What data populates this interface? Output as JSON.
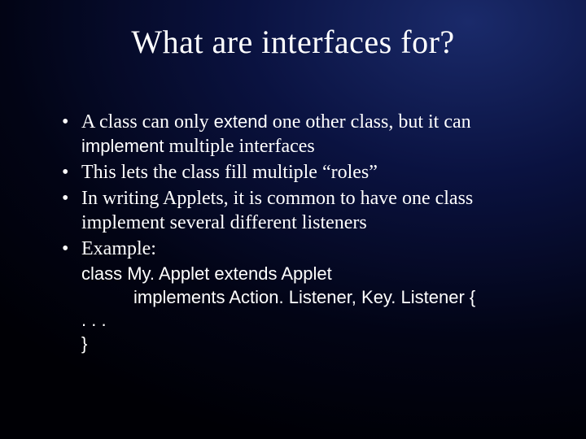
{
  "title": "What are interfaces for?",
  "bullets": {
    "b1a": "A class can only ",
    "b1_kw1": "extend",
    "b1b": " one other class, but it can ",
    "b1_kw2": "implement",
    "b1c": " multiple interfaces",
    "b2": "This lets the class fill multiple “roles”",
    "b3": "In writing Applets, it is common to have one class implement several different listeners",
    "b4": "Example:"
  },
  "code": {
    "l1": "class My. Applet extends Applet",
    "l2": "implements Action. Listener, Key. Listener {",
    "l3": ". . .",
    "l4": "}"
  }
}
